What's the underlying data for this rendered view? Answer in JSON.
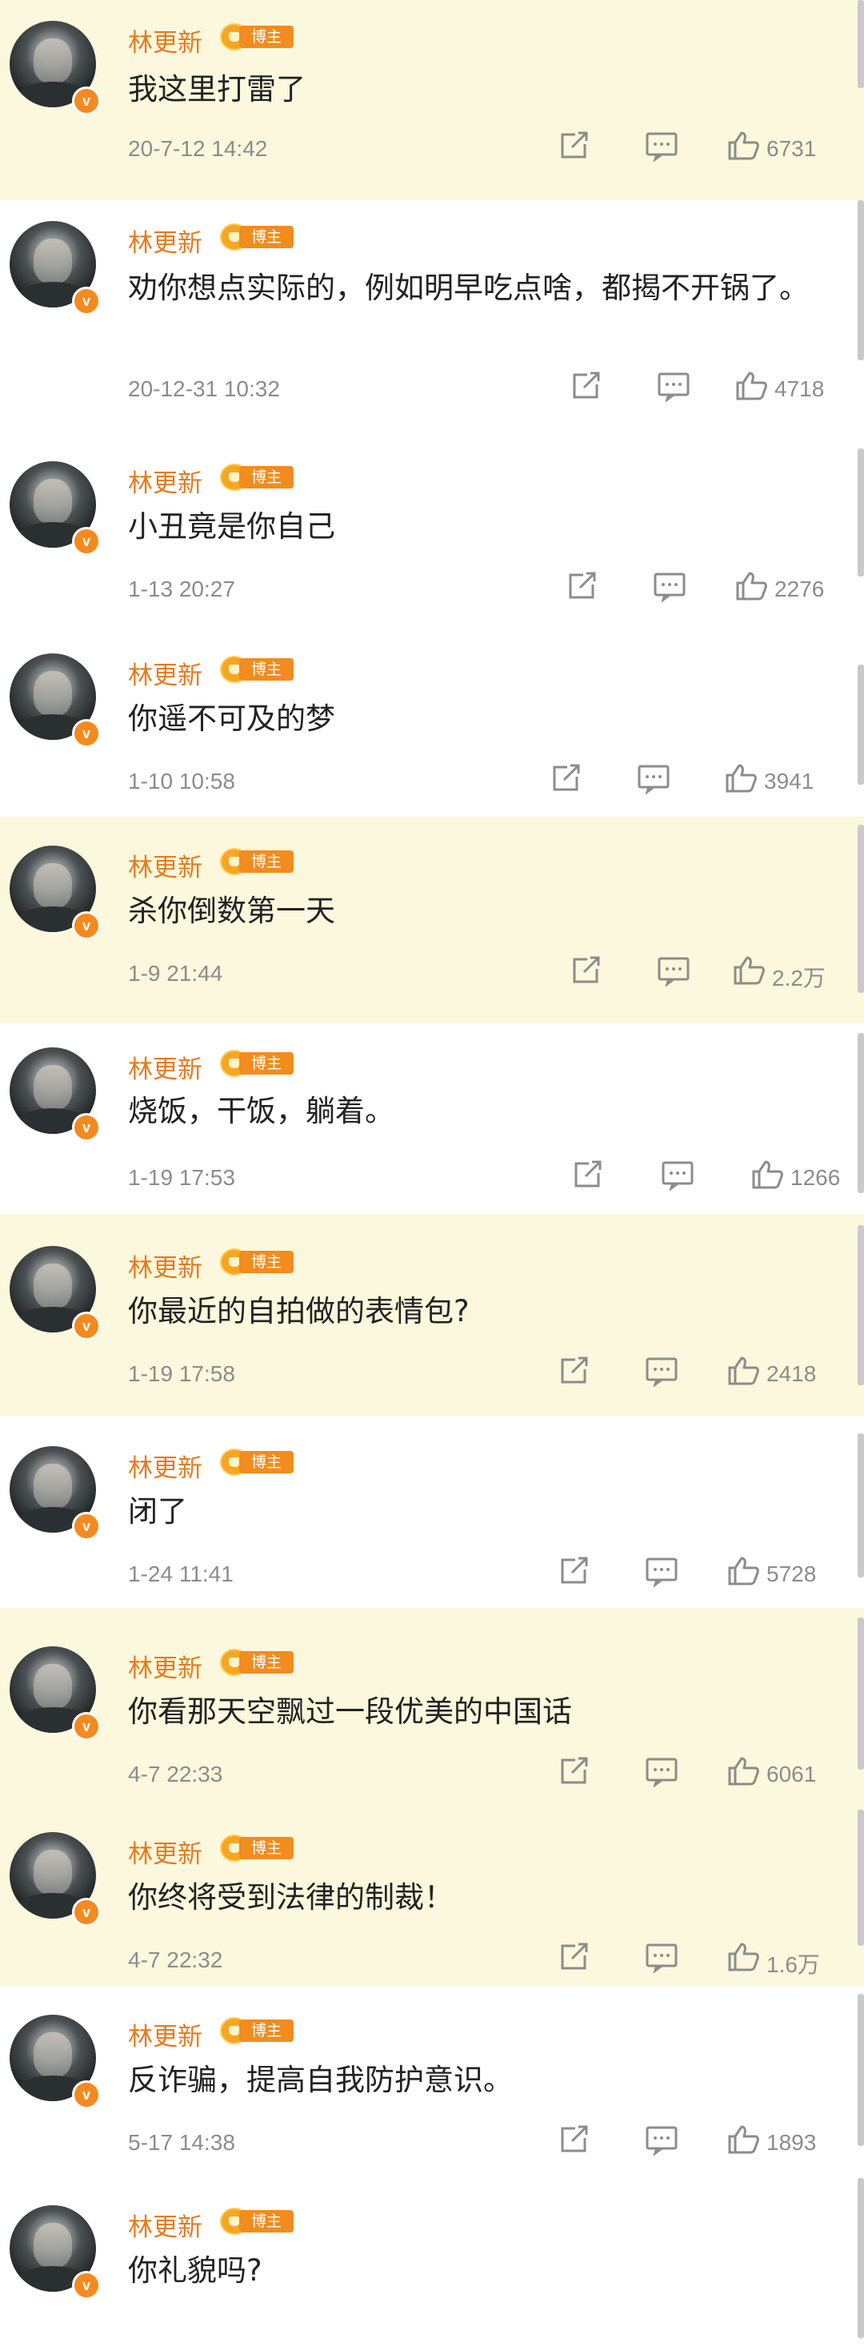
{
  "user": {
    "name": "林更新",
    "role_badge": "博主",
    "verified_mark": "v",
    "avatar": "avatar-icon"
  },
  "icons": {
    "repost": "repost-icon",
    "comment": "comment-icon",
    "like": "thumbs-up-icon"
  },
  "colors": {
    "name": "#e67a1e",
    "highlight_bg": "#fbf8dd",
    "badge": "#f28c1e",
    "meta": "#8c8c8c"
  },
  "comments": [
    {
      "text": "我这里打雷了",
      "time": "20-7-12 14:42",
      "likes": "6731",
      "highlighted": true
    },
    {
      "text": "劝你想点实际的，例如明早吃点啥，都揭不开锅了。",
      "time": "20-12-31 10:32",
      "likes": "4718",
      "highlighted": false
    },
    {
      "text": "小丑竟是你自己",
      "time": "1-13 20:27",
      "likes": "2276",
      "highlighted": false
    },
    {
      "text": "你遥不可及的梦",
      "time": "1-10 10:58",
      "likes": "3941",
      "highlighted": false
    },
    {
      "text": "杀你倒数第一天",
      "time": "1-9 21:44",
      "likes": "2.2万",
      "highlighted": true
    },
    {
      "text": "烧饭，干饭，躺着。",
      "time": "1-19 17:53",
      "likes": "1266",
      "highlighted": false
    },
    {
      "text": "你最近的自拍做的表情包?",
      "time": "1-19 17:58",
      "likes": "2418",
      "highlighted": true
    },
    {
      "text": "闭了",
      "time": "1-24 11:41",
      "likes": "5728",
      "highlighted": false
    },
    {
      "text": "你看那天空飘过一段优美的中国话",
      "time": "4-7 22:33",
      "likes": "6061",
      "highlighted": true
    },
    {
      "text": "你终将受到法律的制裁！",
      "time": "4-7 22:32",
      "likes": "1.6万",
      "highlighted": true
    },
    {
      "text": "反诈骗，提高自我防护意识。",
      "time": "5-17 14:38",
      "likes": "1893",
      "highlighted": false
    },
    {
      "text": "你礼貌吗?",
      "time": "",
      "likes": "",
      "highlighted": false
    }
  ]
}
